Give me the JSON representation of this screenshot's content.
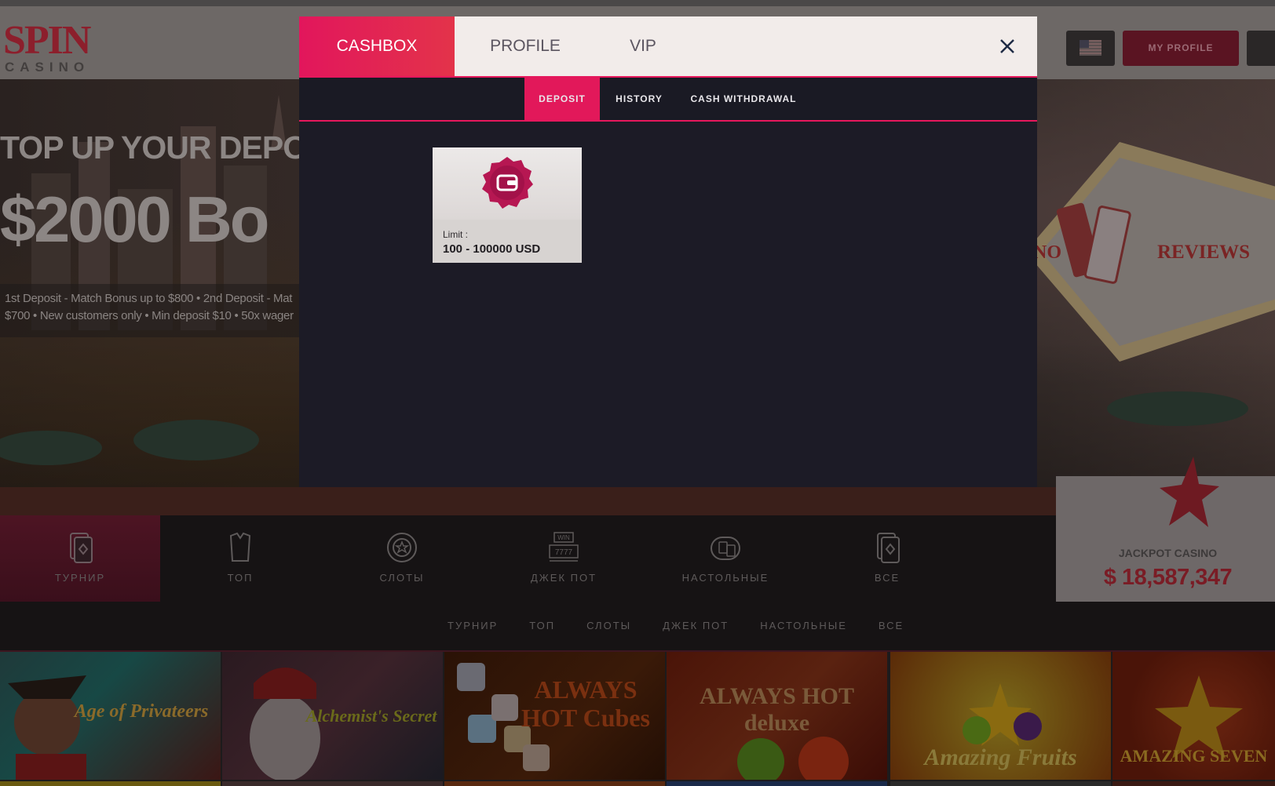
{
  "brand": {
    "logo_main": "SPIN",
    "logo_sub": "CASINO"
  },
  "header": {
    "my_profile_label": "MY PROFILE"
  },
  "hero": {
    "headline": "TOP UP YOUR DEPO",
    "amount": "$2000 Bo",
    "terms_line1": "1st Deposit - Match Bonus up to $800 • 2nd Deposit - Mat",
    "terms_line2": "$700 • New customers only • Min deposit $10 • 50x wager",
    "sign_left": "NO",
    "sign_right": "REVIEWS"
  },
  "jackpot": {
    "label": "JACKPOT CASINO",
    "value": "$ 18,587,347"
  },
  "categories": [
    {
      "label": "ТУРНИР",
      "icon": "card-icon"
    },
    {
      "label": "ТОП",
      "icon": "shirt-icon"
    },
    {
      "label": "СЛОТЫ",
      "icon": "chip-icon"
    },
    {
      "label": "ДЖЕК ПОТ",
      "icon": "slot-machine-icon"
    },
    {
      "label": "НАСТОЛЬНЫЕ",
      "icon": "table-icon"
    },
    {
      "label": "ВСЕ",
      "icon": "card-icon"
    }
  ],
  "slot_icon_text": {
    "win": "WIN",
    "reels": "7777"
  },
  "subnav": [
    "ТУРНИР",
    "ТОП",
    "СЛОТЫ",
    "ДЖЕК ПОТ",
    "НАСТОЛЬНЫЕ",
    "ВСЕ"
  ],
  "games": [
    {
      "name": "Age of Privateers"
    },
    {
      "name": "Alchemist's Secret"
    },
    {
      "name": "ALWAYS HOT Cubes"
    },
    {
      "name": "ALWAYS HOT deluxe"
    },
    {
      "name": "Amazing Fruits"
    },
    {
      "name": "AMAZING SEVEN"
    }
  ],
  "modal": {
    "tabs": [
      {
        "label": "CASHBOX",
        "active": true
      },
      {
        "label": "PROFILE",
        "active": false
      },
      {
        "label": "VIP",
        "active": false
      }
    ],
    "close_icon": "close-icon",
    "subtabs": [
      {
        "label": "DEPOSIT",
        "active": true
      },
      {
        "label": "HISTORY",
        "active": false
      },
      {
        "label": "CASH WITHDRAWAL",
        "active": false
      }
    ],
    "payment_method": {
      "icon": "wallet-icon",
      "limit_label": "Limit :",
      "limit_value": "100 - 100000 USD"
    }
  },
  "colors": {
    "accent": "#e2165c",
    "modal_bg": "#1c1b26",
    "tab_bar_bg": "#f2ecea",
    "jackpot_value": "#7a1c25"
  }
}
